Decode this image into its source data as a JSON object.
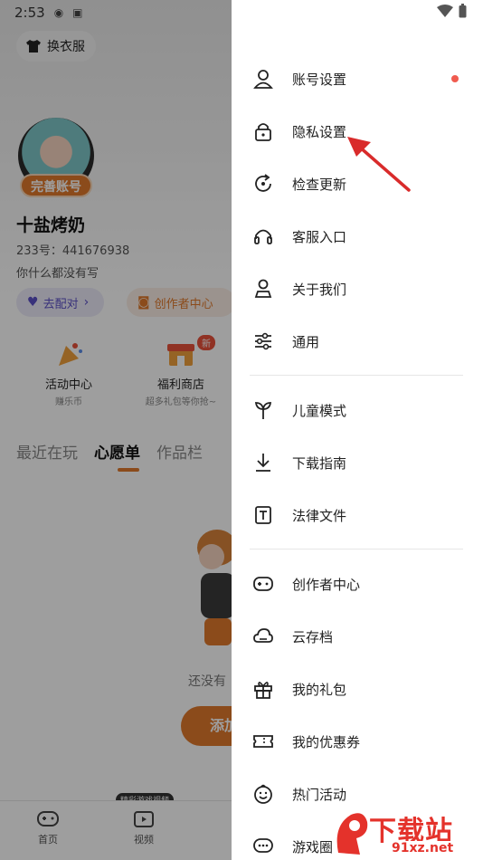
{
  "status_bar": {
    "time": "2:53"
  },
  "background": {
    "outfit_button": "换衣服",
    "complete_badge": "完善账号",
    "username": "十盐烤奶",
    "user_id": "233号：441676938",
    "signature": "你什么都没有写",
    "pill_match": "去配对",
    "pill_creator": "创作者中心",
    "cards": [
      {
        "title": "活动中心",
        "sub": "赚乐币"
      },
      {
        "title": "福利商店",
        "sub": "超多礼包等你抢~",
        "badge": "新"
      }
    ],
    "tabs": [
      "最近在玩",
      "心愿单",
      "作品栏"
    ],
    "empty_text": "还没有",
    "add_button": "添加",
    "nav": [
      {
        "label": "首页",
        "icon": "gamepad-icon"
      },
      {
        "label": "视频",
        "icon": "tv-icon",
        "tip": "精彩游戏视频"
      }
    ]
  },
  "drawer": {
    "group1": [
      {
        "label": "账号设置",
        "icon": "user-icon",
        "has_dot": true
      },
      {
        "label": "隐私设置",
        "icon": "lock-icon"
      },
      {
        "label": "检查更新",
        "icon": "refresh-icon"
      },
      {
        "label": "客服入口",
        "icon": "headset-icon"
      },
      {
        "label": "关于我们",
        "icon": "about-user-icon"
      },
      {
        "label": "通用",
        "icon": "sliders-icon"
      }
    ],
    "group2": [
      {
        "label": "儿童模式",
        "icon": "sprout-icon"
      },
      {
        "label": "下载指南",
        "icon": "download-icon"
      },
      {
        "label": "法律文件",
        "icon": "text-doc-icon"
      }
    ],
    "group3": [
      {
        "label": "创作者中心",
        "icon": "controller-icon"
      },
      {
        "label": "云存档",
        "icon": "cloud-icon"
      },
      {
        "label": "我的礼包",
        "icon": "gift-icon"
      },
      {
        "label": "我的优惠券",
        "icon": "ticket-icon"
      },
      {
        "label": "热门活动",
        "icon": "smile-icon"
      },
      {
        "label": "游戏圈",
        "icon": "chat-icon"
      }
    ]
  },
  "watermark": {
    "brand": "下载站",
    "url": "91xz.net"
  },
  "colors": {
    "accent": "#e07a2d",
    "dot": "#f05b4f",
    "arrow": "#d92b2b"
  }
}
